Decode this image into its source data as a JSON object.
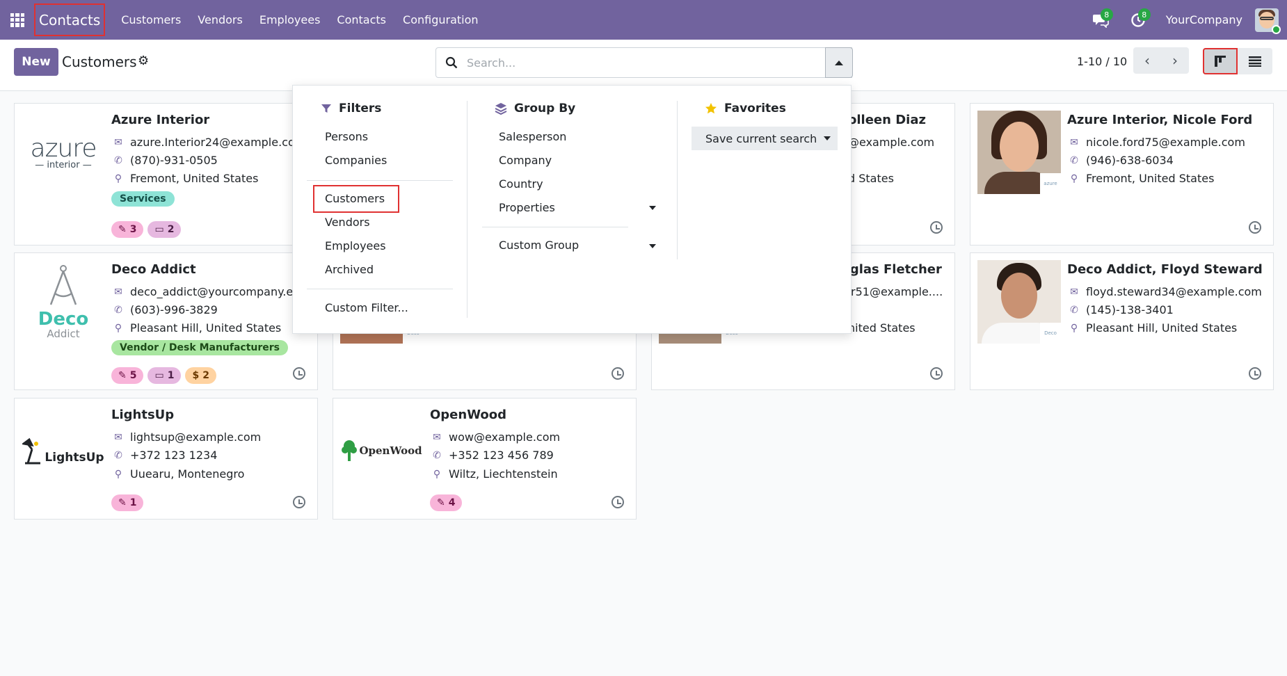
{
  "navbar": {
    "app_name": "Contacts",
    "menu": [
      "Customers",
      "Vendors",
      "Employees",
      "Contacts",
      "Configuration"
    ],
    "messages_count": "8",
    "activities_count": "8",
    "company": "YourCompany"
  },
  "control": {
    "new_label": "New",
    "title": "Customers",
    "search_placeholder": "Search...",
    "pager": "1-10 / 10"
  },
  "filters": {
    "heading": "Filters",
    "items": [
      "Persons",
      "Companies",
      "Customers",
      "Vendors",
      "Employees",
      "Archived",
      "Custom Filter..."
    ]
  },
  "group_by": {
    "heading": "Group By",
    "items": [
      "Salesperson",
      "Company",
      "Country",
      "Properties",
      "Custom Group"
    ]
  },
  "favorites": {
    "heading": "Favorites",
    "save_label": "Save current search"
  },
  "cards": [
    {
      "name": "Azure Interior",
      "email": "azure.Interior24@example.co",
      "phone": "(870)-931-0505",
      "location": "Fremont, United States",
      "tag": "Services",
      "chips": [
        "3",
        "2"
      ],
      "logo_text": "azure",
      "logo_sub": "interior"
    },
    {
      "name": "Deco Addict",
      "email": "deco_addict@yourcompany.e",
      "phone": "(603)-996-3829",
      "location": "Pleasant Hill, United States",
      "tag": "Vendor / Desk Manufacturers",
      "chips": [
        "5",
        "1",
        "2"
      ],
      "logo_text": "Deco",
      "logo_sub": "Addict"
    },
    {
      "name": "LightsUp",
      "email": "lightsup@example.com",
      "phone": "+372 123 1234",
      "location": "Uuearu, Montenegro",
      "chips": [
        "1"
      ],
      "logo_text": "LightsUp"
    },
    {
      "name": "OpenWood",
      "email": "wow@example.com",
      "phone": "+352 123 456 789",
      "location": "Wiltz, Liechtenstein",
      "chips": [
        "4"
      ],
      "logo_text": "OpenWood"
    },
    {
      "name": "olleen Diaz",
      "email": "@example.com",
      "location": "d States"
    },
    {
      "name": "uglas Fletcher",
      "email": "r51@example....",
      "location": "nited States"
    },
    {
      "name": "Azure Interior, Nicole Ford",
      "email": "nicole.ford75@example.com",
      "phone": "(946)-638-6034",
      "location": "Fremont, United States",
      "mini_logo": "azure"
    },
    {
      "name": "Deco Addict, Floyd Steward",
      "email": "floyd.steward34@example.com",
      "phone": "(145)-138-3401",
      "location": "Pleasant Hill, United States",
      "mini_logo": "Deco"
    }
  ],
  "colors": {
    "brand": "#71639e",
    "tag_services": "#8ee3d6",
    "tag_vendor": "#a8e6a0",
    "chip_pink": "#f8b4d9",
    "chip_purple": "#e6b8e0",
    "chip_orange": "#ffd3a1",
    "highlight": "#e03131"
  }
}
